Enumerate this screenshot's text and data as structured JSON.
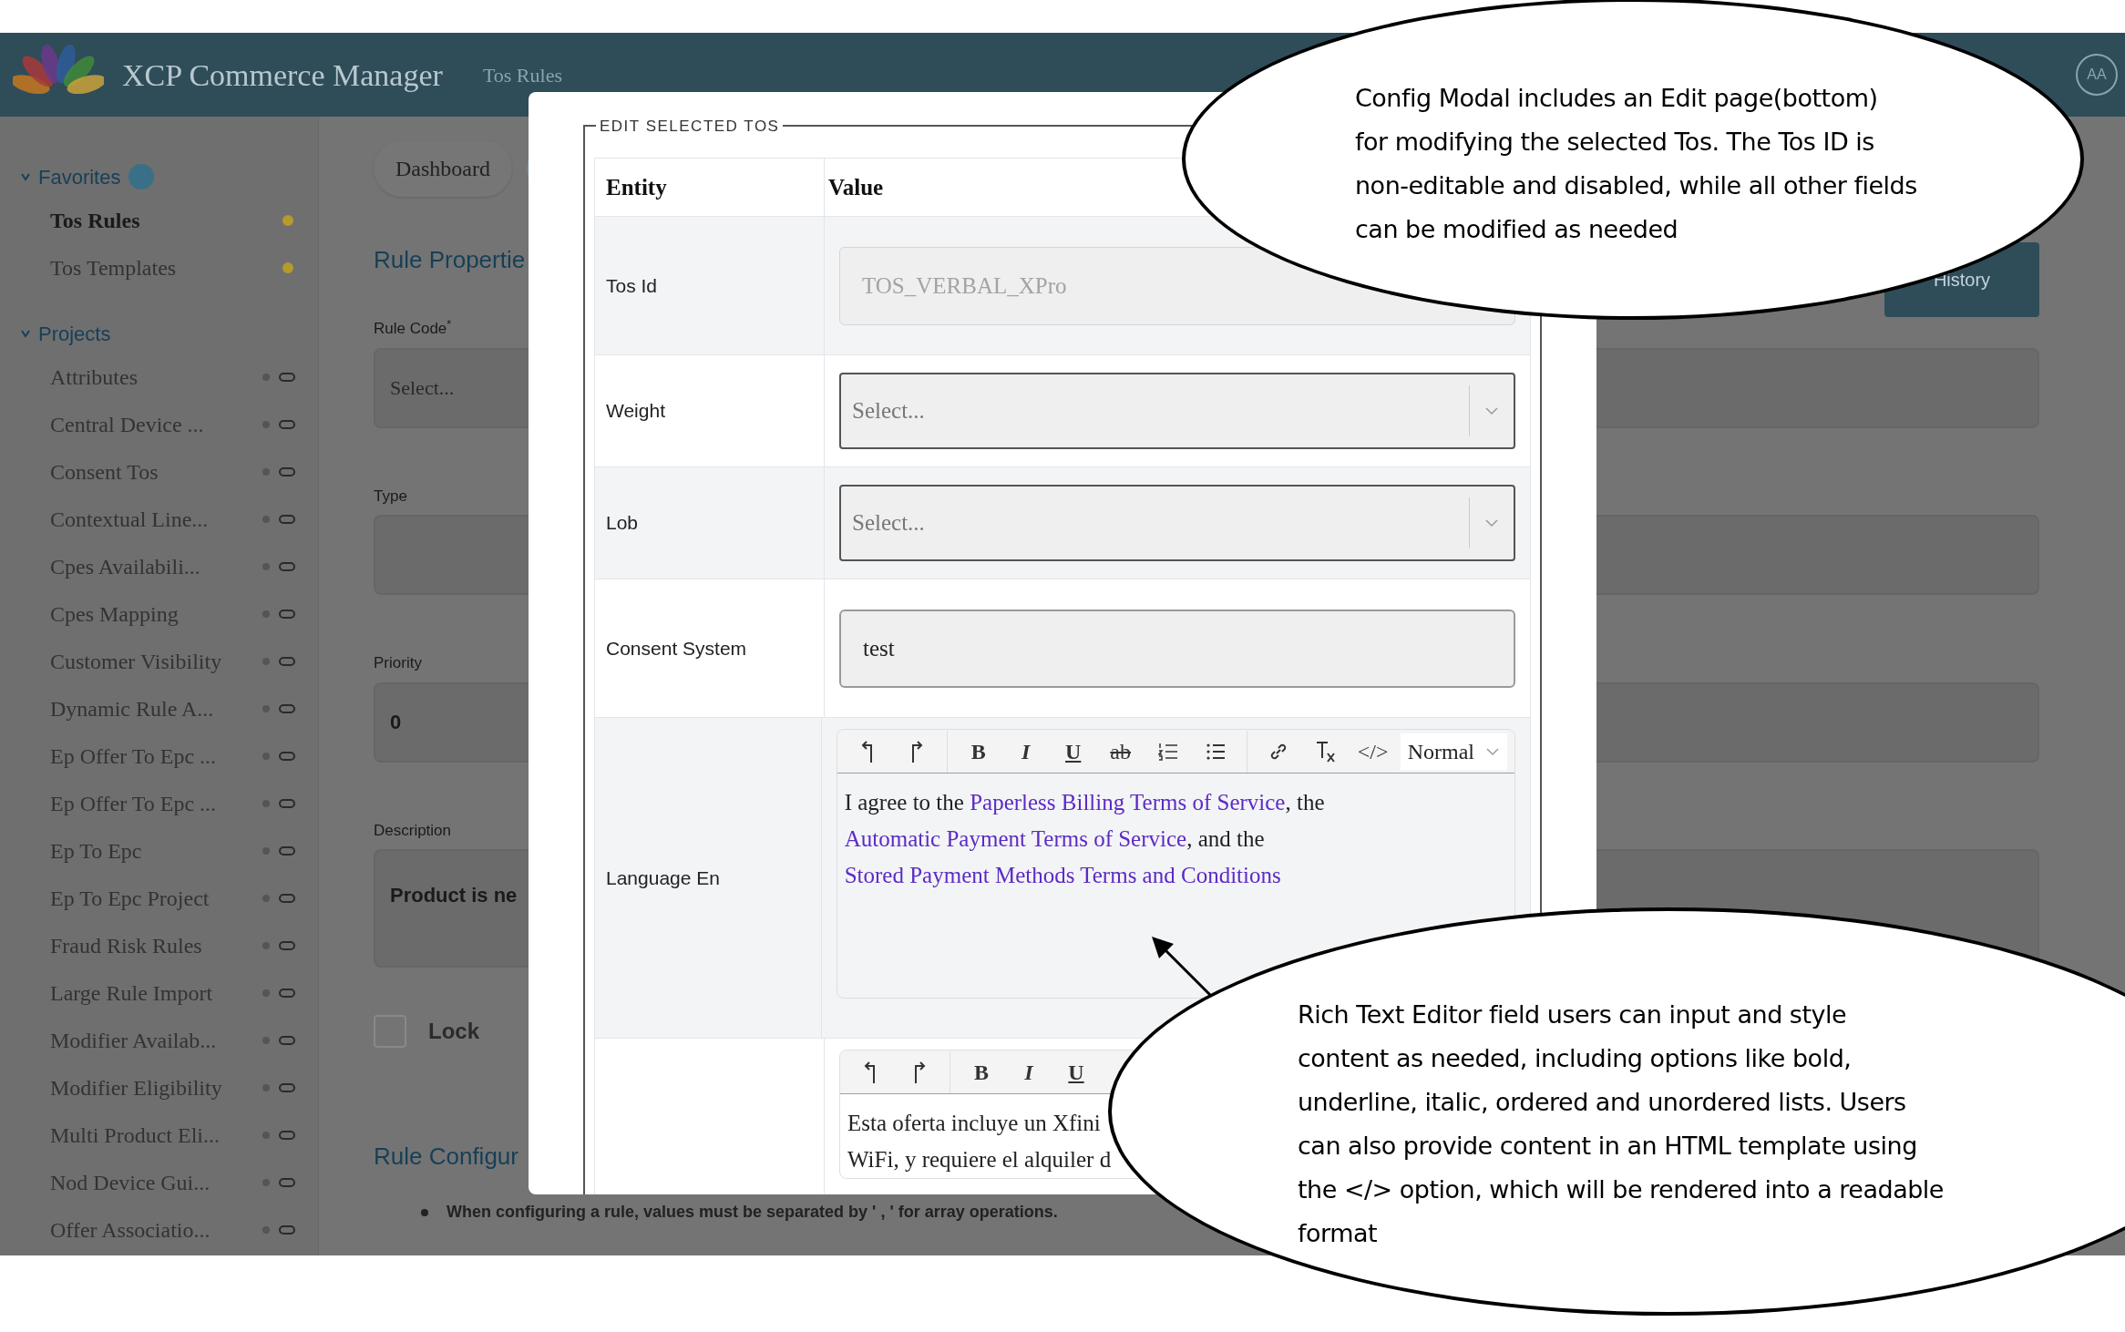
{
  "app": {
    "title": "XCP Commerce Manager",
    "breadcrumb": "Tos Rules",
    "avatar": "AA"
  },
  "sidebar": {
    "sections": [
      {
        "title": "Favorites",
        "expanded": true,
        "kind": "favorites",
        "items": [
          {
            "label": "Tos Rules",
            "selected": true
          },
          {
            "label": "Tos Templates",
            "selected": false
          }
        ]
      },
      {
        "title": "Projects",
        "expanded": true,
        "kind": "projects",
        "items": [
          {
            "label": "Attributes",
            "selected": false
          },
          {
            "label": "Central Device ...",
            "selected": false
          },
          {
            "label": "Consent Tos",
            "selected": false
          },
          {
            "label": "Contextual Line...",
            "selected": false
          },
          {
            "label": "Cpes Availabili...",
            "selected": false
          },
          {
            "label": "Cpes Mapping",
            "selected": false
          },
          {
            "label": "Customer Visibility",
            "selected": false
          },
          {
            "label": "Dynamic Rule A...",
            "selected": false
          },
          {
            "label": "Ep Offer To Epc ...",
            "selected": false
          },
          {
            "label": "Ep Offer To Epc ...",
            "selected": false
          },
          {
            "label": "Ep To Epc",
            "selected": false
          },
          {
            "label": "Ep To Epc Project",
            "selected": false
          },
          {
            "label": "Fraud Risk Rules",
            "selected": false
          },
          {
            "label": "Large Rule Import",
            "selected": false
          },
          {
            "label": "Modifier Availab...",
            "selected": false
          },
          {
            "label": "Modifier Eligibility",
            "selected": false
          },
          {
            "label": "Multi Product Eli...",
            "selected": false
          },
          {
            "label": "Nod Device Gui...",
            "selected": false
          },
          {
            "label": "Offer Associatio...",
            "selected": false
          }
        ]
      }
    ]
  },
  "main": {
    "tabs": [
      {
        "label": "Dashboard",
        "selected": false
      },
      {
        "selected": true
      }
    ],
    "section_title": "Rule Propertie",
    "history_button": "History",
    "fields": [
      {
        "label": "Rule Code$^{*}$",
        "kind": "select",
        "placeholder": "Select..."
      },
      {
        "label": "Type",
        "kind": "text"
      },
      {
        "label": "Priority",
        "kind": "text",
        "value": "0"
      },
      {
        "label": "Description",
        "kind": "textarea",
        "value": "Product is ne"
      }
    ],
    "lock": {
      "label": "Lock",
      "checked": false
    },
    "config_title": "Rule Configur",
    "notes": [
      "When configuring a rule, values must be separated by ' , ' for array operations."
    ]
  },
  "modal": {
    "legend": "EDIT SELECTED TOS",
    "columns": [
      "Entity",
      "Value"
    ],
    "rows": [
      {
        "entity": "Tos Id",
        "kind": "input",
        "value": "TOS_VERBAL_XPro",
        "disabled": true
      },
      {
        "entity": "Weight",
        "kind": "select",
        "placeholder": "Select..."
      },
      {
        "entity": "Lob",
        "kind": "select",
        "placeholder": "Select..."
      },
      {
        "entity": "Consent System",
        "kind": "input",
        "value": "test",
        "disabled": false
      },
      {
        "entity": "Language En",
        "kind": "editor",
        "toolbar": [
          {
            "kind": "undo"
          },
          {
            "kind": "redo"
          },
          {
            "kind": "sep"
          },
          {
            "kind": "bold",
            "label": "B"
          },
          {
            "kind": "italic",
            "label": "I"
          },
          {
            "kind": "underline",
            "label": "U"
          },
          {
            "kind": "strike",
            "label": "ab"
          },
          {
            "kind": "ol"
          },
          {
            "kind": "ul"
          },
          {
            "kind": "sep"
          },
          {
            "kind": "link"
          },
          {
            "kind": "clean"
          },
          {
            "kind": "code",
            "label": "</>"
          },
          {
            "kind": "header",
            "label": "Normal"
          }
        ],
        "content": [
          {
            "text": "I agree to the ",
            "link": false
          },
          {
            "text": "Paperless Billing Terms of Service",
            "link": true
          },
          {
            "text": ", the ",
            "link": false
          },
          {
            "text": "Automatic Payment Terms of Service",
            "link": true
          },
          {
            "text": ", and the ",
            "link": false
          },
          {
            "text": "Stored Payment Methods Terms and Conditions",
            "link": true
          }
        ]
      },
      {
        "kind": "editor",
        "toolbar": [
          {
            "kind": "undo"
          },
          {
            "kind": "redo"
          },
          {
            "kind": "sep"
          },
          {
            "kind": "bold",
            "label": "B"
          },
          {
            "kind": "italic",
            "label": "I"
          },
          {
            "kind": "underline",
            "label": "U"
          }
        ],
        "lines": [
          "Esta oferta incluye un Xfini",
          "WiFi, y requiere el alquiler d"
        ]
      }
    ]
  },
  "callouts": [
    {
      "lines": [
        "Config Modal includes an Edit page(bottom)",
        "for modifying the selected Tos. The Tos ID is",
        "non-editable and disabled, while all other fields",
        "can be modified as needed"
      ]
    },
    {
      "lines": [
        "Rich Text Editor field users can input and style",
        "content as needed, including options like bold,",
        "underline, italic, ordered and unordered lists. Users",
        "can also provide content in an HTML template using",
        "the </> option, which will be rendered into a readable",
        "format"
      ],
      "arrow": true
    }
  ]
}
